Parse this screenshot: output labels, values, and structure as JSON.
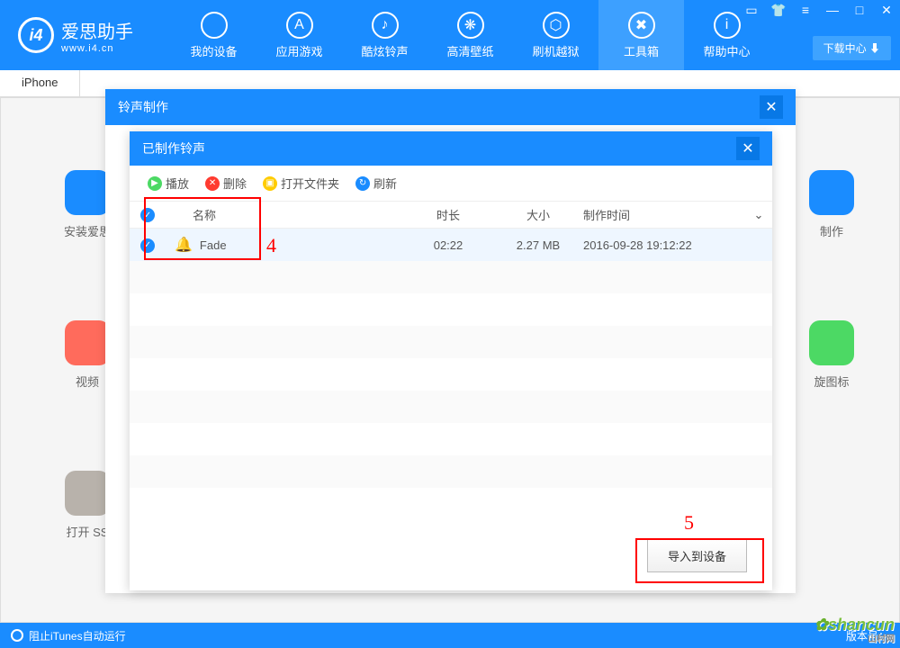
{
  "app": {
    "name": "爱思助手",
    "site": "www.i4.cn"
  },
  "nav": [
    {
      "label": "我的设备",
      "icon": ""
    },
    {
      "label": "应用游戏",
      "icon": "A"
    },
    {
      "label": "酷炫铃声",
      "icon": "♪"
    },
    {
      "label": "高清壁纸",
      "icon": "❋"
    },
    {
      "label": "刷机越狱",
      "icon": "⬡"
    },
    {
      "label": "工具箱",
      "icon": "✖"
    },
    {
      "label": "帮助中心",
      "icon": "i"
    }
  ],
  "download_center": "下载中心 ⬇",
  "subtab": "iPhone",
  "side_left": [
    {
      "label": "安装爱思"
    },
    {
      "label": "视频"
    },
    {
      "label": "打开 SS"
    }
  ],
  "side_right": [
    {
      "label": "制作"
    },
    {
      "label": "旋图标"
    }
  ],
  "modal1": {
    "title": "铃声制作"
  },
  "modal2": {
    "title": "已制作铃声"
  },
  "toolbar": {
    "play": "播放",
    "delete": "删除",
    "open_folder": "打开文件夹",
    "refresh": "刷新"
  },
  "table": {
    "headers": {
      "name": "名称",
      "duration": "时长",
      "size": "大小",
      "created": "制作时间"
    },
    "rows": [
      {
        "name": "Fade",
        "duration": "02:22",
        "size": "2.27 MB",
        "created": "2016-09-28 19:12:22"
      }
    ]
  },
  "import_btn": "导入到设备",
  "annotations": {
    "a4": "4",
    "a5": "5"
  },
  "status": {
    "left": "阻止iTunes自动运行",
    "right": "版本号："
  },
  "watermark": {
    "text": "shancun",
    "sub": "山村网"
  }
}
